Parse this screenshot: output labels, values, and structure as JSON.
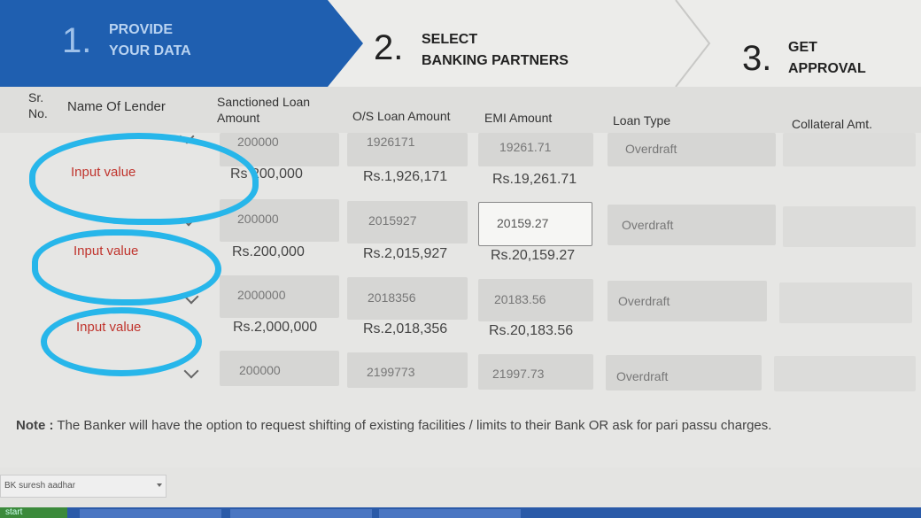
{
  "stepper": [
    {
      "num": "1.",
      "label": "PROVIDE\nYOUR DATA"
    },
    {
      "num": "2.",
      "label": "SELECT\nBANKING PARTNERS"
    },
    {
      "num": "3.",
      "label": "GET\nAPPROVAL"
    }
  ],
  "headers": {
    "sr": "Sr.\nNo.",
    "lender": "Name Of Lender",
    "sanctioned": "Sanctioned Loan\nAmount",
    "os": "O/S Loan Amount",
    "emi": "EMI Amount",
    "type": "Loan Type",
    "collateral": "Collateral Amt."
  },
  "rows": [
    {
      "lender": "Input value",
      "sanctioned": "200000",
      "sanctioned_fmt": "Rs 200,000",
      "os": "1926171",
      "os_fmt": "Rs.1,926,171",
      "emi": "19261.71",
      "emi_fmt": "Rs.19,261.71",
      "type": "Overdraft",
      "collateral": ""
    },
    {
      "lender": "Input value",
      "sanctioned": "200000",
      "sanctioned_fmt": "Rs.200,000",
      "os": "2015927",
      "os_fmt": "Rs.2,015,927",
      "emi": "20159.27",
      "emi_fmt": "Rs.20,159.27",
      "type": "Overdraft",
      "collateral": ""
    },
    {
      "lender": "Input value",
      "sanctioned": "2000000",
      "sanctioned_fmt": "Rs.2,000,000",
      "os": "2018356",
      "os_fmt": "Rs.2,018,356",
      "emi": "20183.56",
      "emi_fmt": "Rs.20,183.56",
      "type": "Overdraft",
      "collateral": ""
    },
    {
      "lender": "",
      "sanctioned": "200000",
      "sanctioned_fmt": "",
      "os": "2199773",
      "os_fmt": "",
      "emi": "21997.73",
      "emi_fmt": "",
      "type": "Overdraft",
      "collateral": ""
    }
  ],
  "note": {
    "prefix": "Note :",
    "text": " The Banker will have the option to request shifting of existing facilities / limits to their Bank OR ask for pari passu charges."
  },
  "footer": {
    "select_value": "BK suresh aadhar",
    "start_label": "start"
  },
  "colors": {
    "primary": "#1f5fb0",
    "annotation": "#27b6ea",
    "input_text": "#c0342d"
  }
}
